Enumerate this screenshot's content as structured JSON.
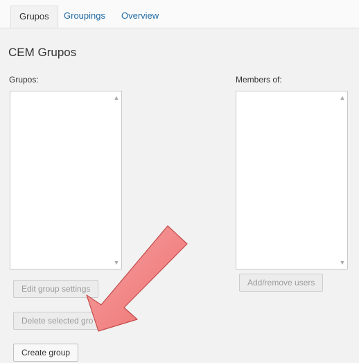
{
  "tabs": [
    {
      "label": "Grupos",
      "active": true
    },
    {
      "label": "Groupings",
      "active": false
    },
    {
      "label": "Overview",
      "active": false
    }
  ],
  "page": {
    "title": "CEM Grupos",
    "groups_label": "Grupos:",
    "members_label": "Members of:"
  },
  "buttons": {
    "edit_group_settings": "Edit group settings",
    "delete_selected_group": "Delete selected gro",
    "create_group": "Create group",
    "add_remove_users": "Add/remove users"
  },
  "icons": {
    "scroll_up": "▲",
    "scroll_down": "▼"
  },
  "annotation": {
    "type": "pointer-arrow",
    "color": "#f07878",
    "points_to": "create-group-button"
  }
}
